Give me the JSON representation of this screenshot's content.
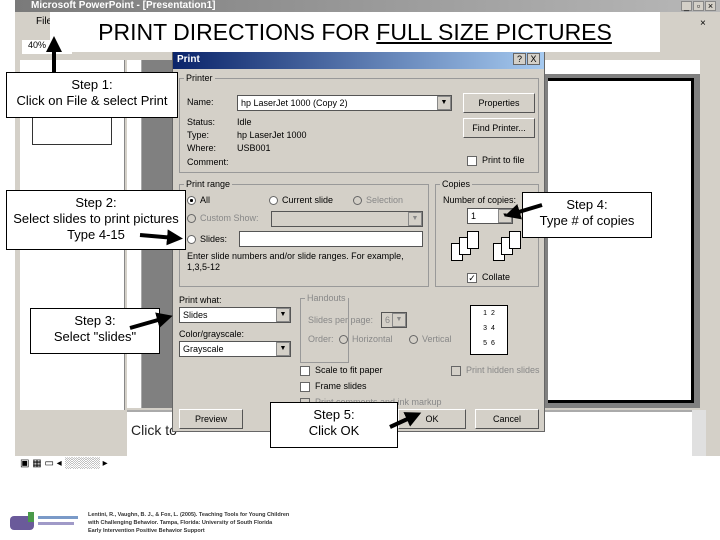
{
  "window": {
    "title": "Microsoft PowerPoint - [Presentation1]",
    "menu_file": "File",
    "zoom": "40%",
    "notes_placeholder": "Click to"
  },
  "slide_title": {
    "prefix": "PRINT DIRECTIONS FOR ",
    "underlined": "FULL SIZE PICTURES"
  },
  "dialog": {
    "title": "Print",
    "help": "?",
    "close": "X",
    "printer": {
      "legend": "Printer",
      "name_label": "Name:",
      "name_value": "hp LaserJet 1000 (Copy 2)",
      "status_label": "Status:",
      "status_value": "Idle",
      "type_label": "Type:",
      "type_value": "hp LaserJet 1000",
      "where_label": "Where:",
      "where_value": "USB001",
      "comment_label": "Comment:",
      "properties": "Properties",
      "find_printer": "Find Printer...",
      "print_to_file": "Print to file"
    },
    "range": {
      "legend": "Print range",
      "all": "All",
      "current": "Current slide",
      "selection": "Selection",
      "custom": "Custom Show:",
      "slides": "Slides:",
      "hint": "Enter slide numbers and/or slide ranges. For example, 1,3,5-12"
    },
    "copies": {
      "legend": "Copies",
      "number_label": "Number of copies:",
      "number_value": "1",
      "collate": "Collate"
    },
    "print_what": {
      "label": "Print what:",
      "value": "Slides"
    },
    "color": {
      "label": "Color/grayscale:",
      "value": "Grayscale"
    },
    "handouts": {
      "legend": "Handouts",
      "per_page_label": "Slides per page:",
      "per_page_value": "6",
      "order_label": "Order:",
      "horizontal": "Horizontal",
      "vertical": "Vertical"
    },
    "options": {
      "scale": "Scale to fit paper",
      "frame": "Frame slides",
      "comments": "Print comments and ink markup",
      "hidden": "Print hidden slides"
    },
    "preview": "Preview",
    "ok": "OK",
    "cancel": "Cancel"
  },
  "callouts": {
    "step1": [
      "Step 1:",
      "Click on File &  select Print"
    ],
    "step2": [
      "Step 2:",
      "Select slides to print pictures",
      "Type 4-15"
    ],
    "step3": [
      "Step 3:",
      "Select \"slides\""
    ],
    "step4": [
      "Step 4:",
      "Type # of copies"
    ],
    "step5": [
      "Step 5:",
      "Click OK"
    ]
  },
  "citation": [
    "Lentini, R., Vaughn, B. J., & Fox, L. (2005). Teaching Tools for Young Children",
    "with Challenging Behavior. Tampa, Florida: University of South Florida",
    "Early Intervention Positive Behavior Support"
  ],
  "logo_text": "Teaching Tools for Young Children"
}
